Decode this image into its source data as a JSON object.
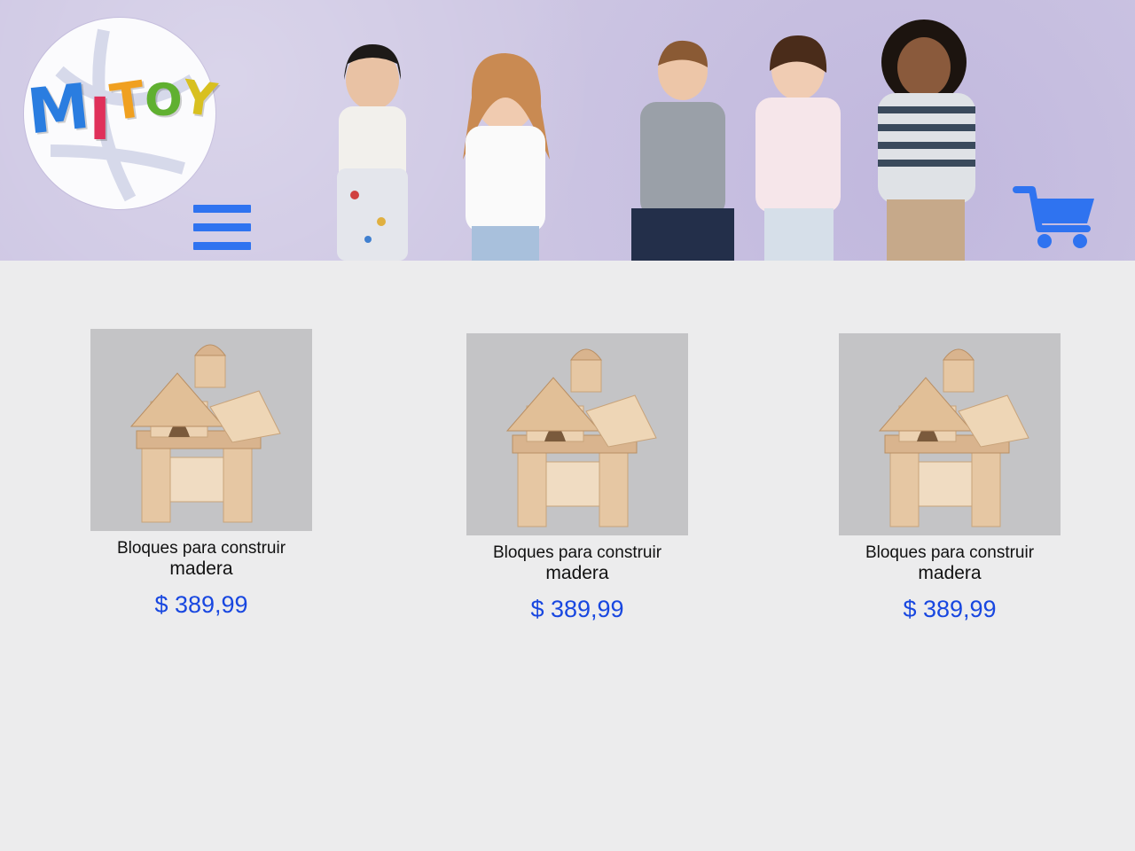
{
  "brand": {
    "logo_letters": [
      "M",
      "I",
      "T",
      "O",
      "Y"
    ],
    "logo_colors": [
      "#2a7de0",
      "#e0305a",
      "#f0a020",
      "#60b030",
      "#d8c020"
    ]
  },
  "header": {
    "menu_icon": "hamburger-menu-icon",
    "cart_icon": "shopping-cart-icon",
    "accent": "#2f73f0"
  },
  "products": [
    {
      "title": "Bloques para construir",
      "subtitle": "madera",
      "price": "$ 389,99"
    },
    {
      "title": "Bloques para construir",
      "subtitle": "madera",
      "price": "$ 389,99"
    },
    {
      "title": "Bloques para construir",
      "subtitle": "madera",
      "price": "$ 389,99"
    }
  ],
  "colors": {
    "price": "#1847e0",
    "header_bg": "#cdc6e3",
    "page_bg": "#ececed"
  }
}
